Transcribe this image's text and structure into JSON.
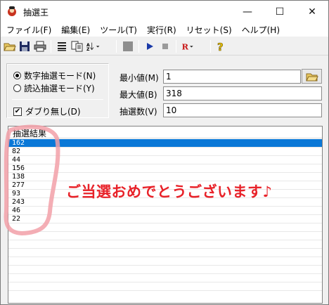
{
  "window": {
    "title": "抽選王",
    "minimize_glyph": "—",
    "maximize_glyph": "☐",
    "close_glyph": "✕"
  },
  "menu": [
    {
      "label": "ファイル(F)"
    },
    {
      "label": "編集(E)"
    },
    {
      "label": "ツール(T)"
    },
    {
      "label": "実行(R)"
    },
    {
      "label": "リセット(S)"
    },
    {
      "label": "ヘルプ(H)"
    }
  ],
  "toolbar": {
    "icons": [
      "open-folder-icon",
      "save-icon",
      "print-icon",
      "list-icon",
      "copy-icon",
      "sort-icon",
      "stop-square-icon",
      "play-icon",
      "stop-icon",
      "reset-r-icon",
      "help-icon"
    ]
  },
  "mode": {
    "number_label": "数字抽選モード(N)",
    "read_label": "読込抽選モード(Y)",
    "selected": "number",
    "no_duplicate_label": "ダブり無し(D)",
    "no_duplicate_checked": true
  },
  "fields": {
    "min_label": "最小値(M)",
    "min_value": "1",
    "max_label": "最大値(B)",
    "max_value": "318",
    "count_label": "抽選数(V)",
    "count_value": "10"
  },
  "results": {
    "header": "抽選結果",
    "values": [
      "162",
      "82",
      "44",
      "156",
      "138",
      "277",
      "93",
      "243",
      "46",
      "22"
    ],
    "selected_index": 0,
    "message": "ご当選おめでとうございます♪"
  },
  "colors": {
    "selection": "#0a78d7",
    "message": "#e82229",
    "highlight_marker": "#f2a0a8"
  }
}
